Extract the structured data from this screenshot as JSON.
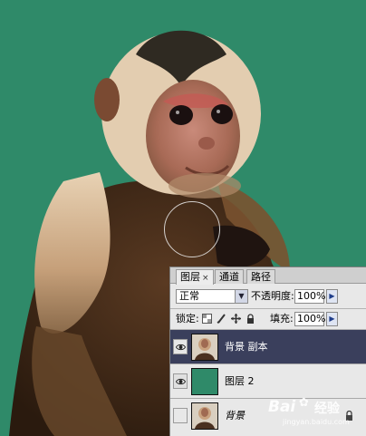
{
  "layers_panel": {
    "tabs": [
      {
        "label": "图层",
        "close": "×",
        "active": true
      },
      {
        "label": "通道",
        "active": false
      },
      {
        "label": "路径",
        "active": false
      }
    ],
    "blend_mode": "正常",
    "opacity_label": "不透明度:",
    "opacity_value": "100%",
    "lock_label": "锁定:",
    "fill_label": "填充:",
    "fill_value": "100%",
    "lock_icons": [
      "lock-transparent-pixels-icon",
      "lock-image-pixels-icon",
      "lock-position-icon",
      "lock-all-icon"
    ],
    "layers": [
      {
        "name": "背景 副本",
        "visible": true,
        "selected": true,
        "thumb": "monkey-photo-thumbnail",
        "locked": false
      },
      {
        "name": "图层 2",
        "visible": true,
        "selected": false,
        "thumb": "green-fill-thumbnail",
        "locked": false
      },
      {
        "name": "背景",
        "visible": false,
        "selected": false,
        "thumb": "monkey-photo-thumbnail",
        "locked": true
      }
    ]
  },
  "watermark": {
    "brand": "Bai",
    "cn": "经验",
    "sub": "jingyan.baidu.com"
  },
  "colors": {
    "canvas_bg": "#2f8a69",
    "selected_layer": "#3a3f5c",
    "layer2_fill": "#2f8a69"
  }
}
